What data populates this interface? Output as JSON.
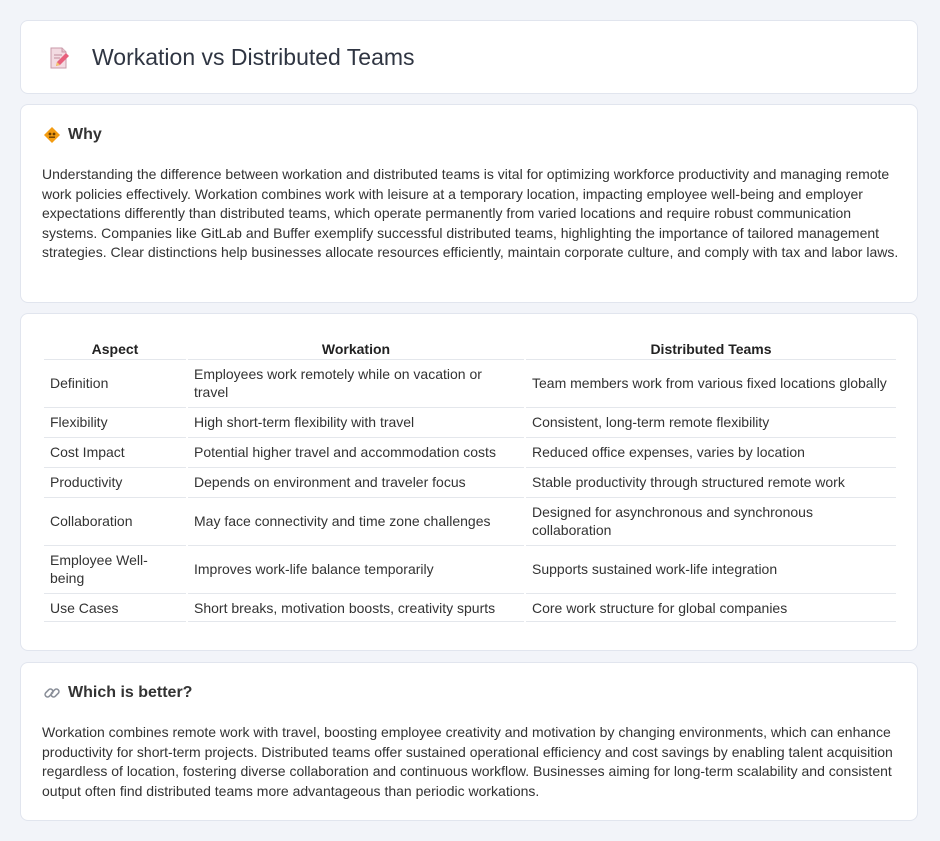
{
  "page": {
    "title": "Workation vs Distributed Teams"
  },
  "why": {
    "heading": "Why",
    "text": "Understanding the difference between workation and distributed teams is vital for optimizing workforce productivity and managing remote work policies effectively. Workation combines work with leisure at a temporary location, impacting employee well-being and employer expectations differently than distributed teams, which operate permanently from varied locations and require robust communication systems. Companies like GitLab and Buffer exemplify successful distributed teams, highlighting the importance of tailored management strategies. Clear distinctions help businesses allocate resources efficiently, maintain corporate culture, and comply with tax and labor laws."
  },
  "table": {
    "headers": [
      "Aspect",
      "Workation",
      "Distributed Teams"
    ],
    "rows": [
      [
        "Definition",
        "Employees work remotely while on vacation or travel",
        "Team members work from various fixed locations globally"
      ],
      [
        "Flexibility",
        "High short-term flexibility with travel",
        "Consistent, long-term remote flexibility"
      ],
      [
        "Cost Impact",
        "Potential higher travel and accommodation costs",
        "Reduced office expenses, varies by location"
      ],
      [
        "Productivity",
        "Depends on environment and traveler focus",
        "Stable productivity through structured remote work"
      ],
      [
        "Collaboration",
        "May face connectivity and time zone challenges",
        "Designed for asynchronous and synchronous collaboration"
      ],
      [
        "Employee Well-being",
        "Improves work-life balance temporarily",
        "Supports sustained work-life integration"
      ],
      [
        "Use Cases",
        "Short breaks, motivation boosts, creativity spurts",
        "Core work structure for global companies"
      ]
    ]
  },
  "better": {
    "heading": "Which is better?",
    "text": "Workation combines remote work with travel, boosting employee creativity and motivation by changing environments, which can enhance productivity for short-term projects. Distributed teams offer sustained operational efficiency and cost savings by enabling talent acquisition regardless of location, fostering diverse collaboration and continuous workflow. Businesses aiming for long-term scalability and consistent output often find distributed teams more advantageous than periodic workations."
  },
  "icons": {
    "title": "document-pencil-icon",
    "why": "diamond-sign-icon",
    "better": "link-icon"
  },
  "colors": {
    "accent_orange": "#f39c12",
    "icon_pink": "#e06a86",
    "background": "#f2f4f9"
  }
}
